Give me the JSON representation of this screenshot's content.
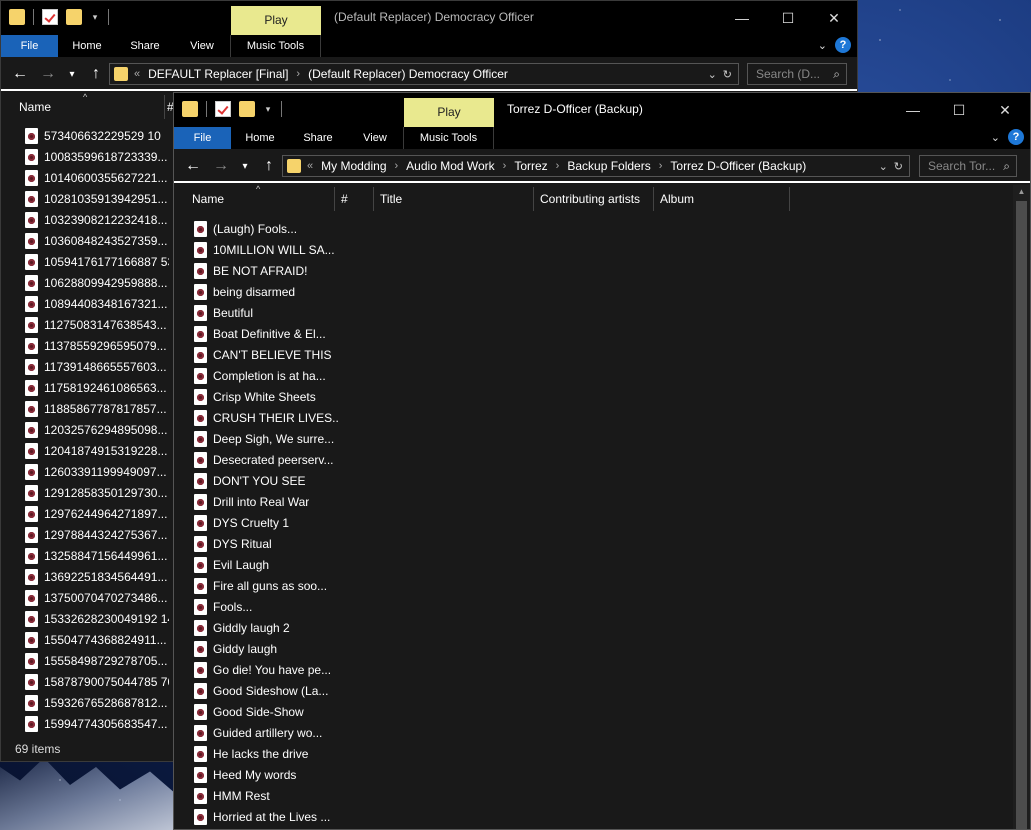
{
  "back_window": {
    "title": "(Default Replacer) Democracy Officer",
    "context_tab": "Play",
    "ribbon_tabs": [
      "File",
      "Home",
      "Share",
      "View",
      "Music Tools"
    ],
    "address": {
      "overflow": "«",
      "crumbs": [
        "DEFAULT Replacer [Final]",
        "(Default Replacer) Democracy Officer"
      ]
    },
    "search_placeholder": "Search (D...",
    "columns": {
      "name": "Name",
      "number": "#"
    },
    "files": [
      "573406632229529 10",
      "10083599618723339...",
      "10140600355627221...",
      "10281035913942951...",
      "10323908212232418...",
      "10360848243527359...",
      "10594176177166887 53",
      "10628809942959888...",
      "10894408348167321...",
      "11275083147638543...",
      "11378559296595079...",
      "11739148665557603...",
      "11758192461086563...",
      "11885867787817857...",
      "12032576294895098...",
      "12041874915319228...",
      "12603391199949097...",
      "12912858350129730...",
      "12976244964271897...",
      "12978844324275367...",
      "13258847156449961...",
      "13692251834564491...",
      "13750070470273486...",
      "15332628230049192 14",
      "15504774368824911...",
      "15558498729278705...",
      "15878790075044785 70",
      "15932676528687812...",
      "15994774305683547..."
    ],
    "status": "69 items"
  },
  "front_window": {
    "title": "Torrez D-Officer (Backup)",
    "context_tab": "Play",
    "ribbon_tabs": [
      "File",
      "Home",
      "Share",
      "View",
      "Music Tools"
    ],
    "address": {
      "overflow": "«",
      "crumbs": [
        "My Modding",
        "Audio Mod Work",
        "Torrez",
        "Backup Folders",
        "Torrez D-Officer (Backup)"
      ]
    },
    "search_placeholder": "Search Tor...",
    "columns": {
      "name": "Name",
      "number": "#",
      "title": "Title",
      "artists": "Contributing artists",
      "album": "Album"
    },
    "files": [
      "(Laugh) Fools...",
      "10MILLION WILL SA...",
      "BE NOT AFRAID!",
      "being disarmed",
      "Beutiful",
      "Boat Definitive & El...",
      "CAN'T BELIEVE THIS",
      "Completion is at ha...",
      "Crisp White Sheets",
      "CRUSH THEIR LIVES...",
      "Deep Sigh, We surre...",
      "Desecrated peerserv...",
      "DON'T YOU SEE",
      "Drill into Real War",
      "DYS Cruelty 1",
      "DYS Ritual",
      "Evil Laugh",
      "Fire all guns as soo...",
      "Fools...",
      "Giddly laugh 2",
      "Giddy laugh",
      "Go die! You have pe...",
      "Good Sideshow (La...",
      "Good Side-Show",
      "Guided artillery wo...",
      "He lacks the drive",
      "Heed My words",
      "HMM Rest",
      "Horried at the Lives ..."
    ]
  },
  "colors": {
    "ribbon_file": "#1a63b8",
    "context_tab": "#e9e98f",
    "folder": "#f6d36b",
    "help": "#1e78d7"
  }
}
